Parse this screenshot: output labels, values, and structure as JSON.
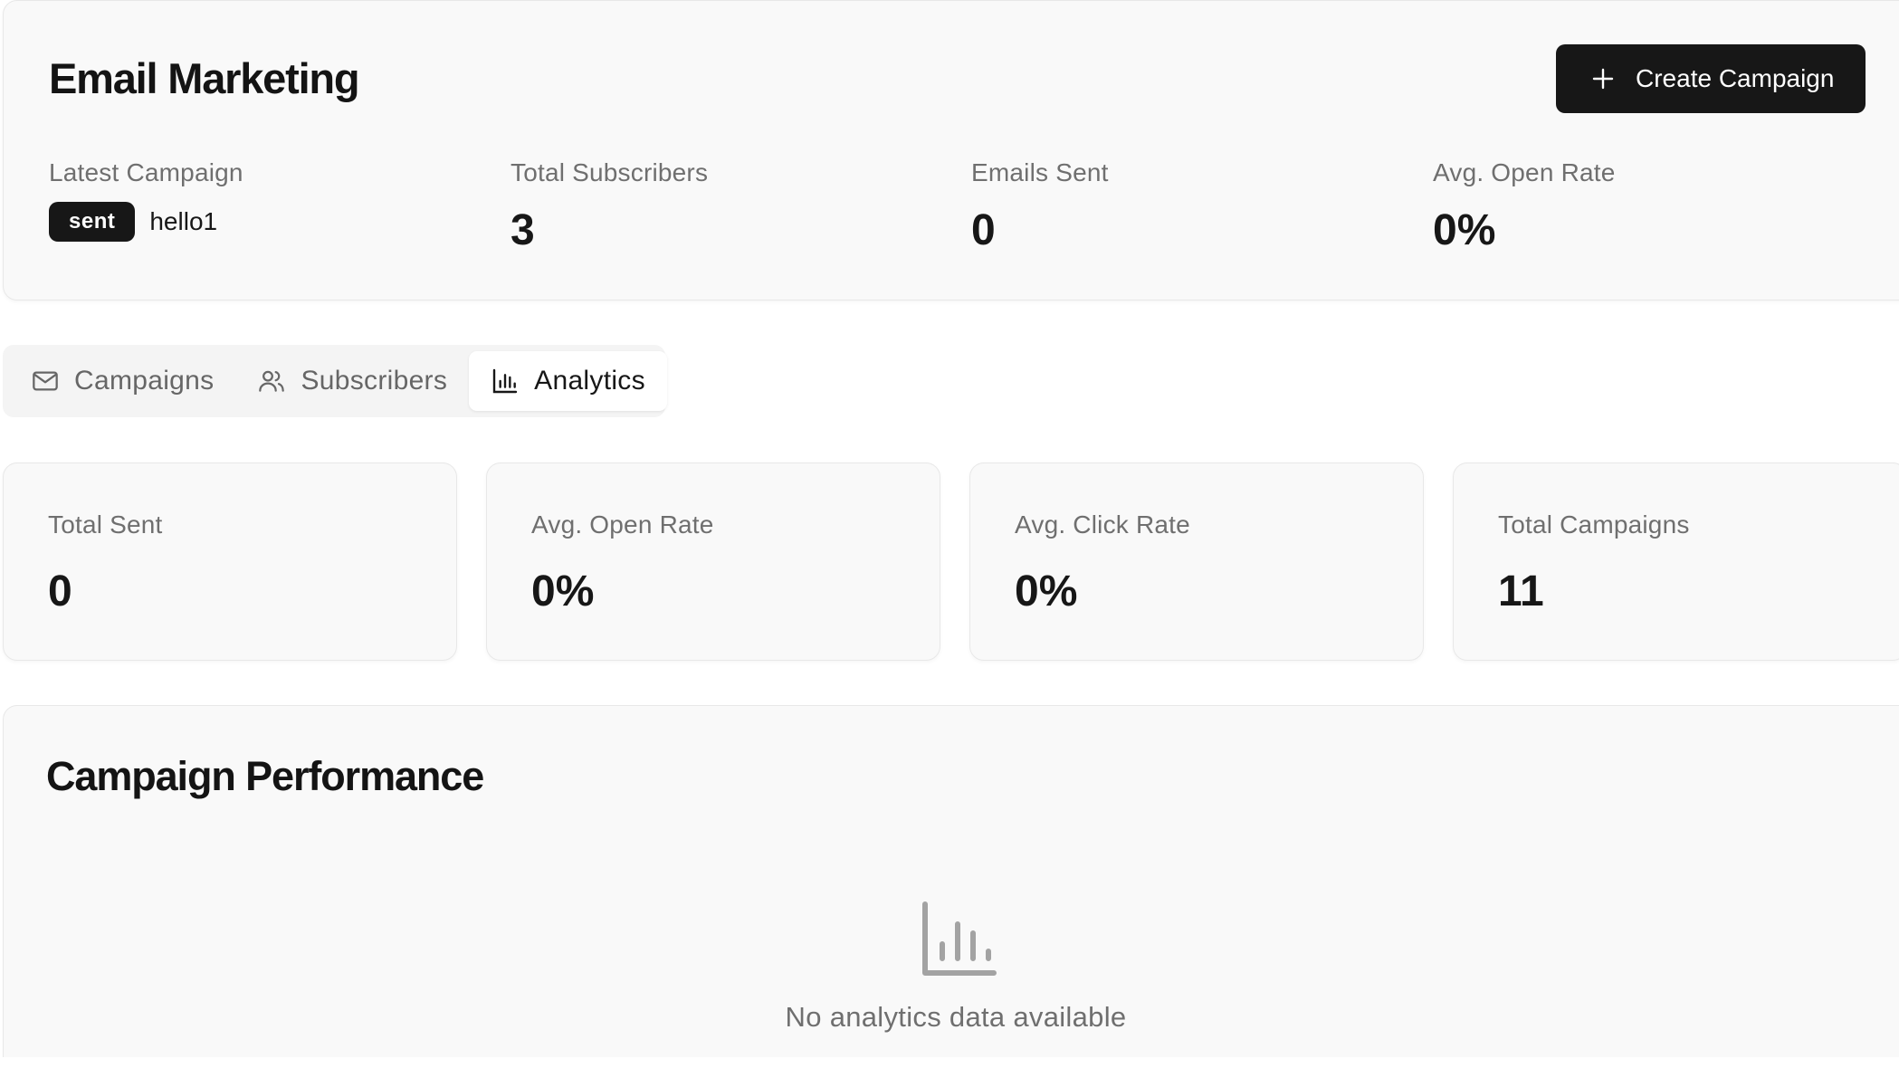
{
  "header": {
    "title": "Email Marketing",
    "create_button_label": "Create Campaign"
  },
  "summary": {
    "latest_campaign": {
      "label": "Latest Campaign",
      "status": "sent",
      "name": "hello1"
    },
    "total_subscribers": {
      "label": "Total Subscribers",
      "value": "3"
    },
    "emails_sent": {
      "label": "Emails Sent",
      "value": "0"
    },
    "avg_open_rate": {
      "label": "Avg. Open Rate",
      "value": "0%"
    }
  },
  "tabs": [
    {
      "label": "Campaigns",
      "icon": "mail-icon",
      "active": false
    },
    {
      "label": "Subscribers",
      "icon": "users-icon",
      "active": false
    },
    {
      "label": "Analytics",
      "icon": "bar-chart-icon",
      "active": true
    }
  ],
  "metrics": [
    {
      "label": "Total Sent",
      "value": "0"
    },
    {
      "label": "Avg. Open Rate",
      "value": "0%"
    },
    {
      "label": "Avg. Click Rate",
      "value": "0%"
    },
    {
      "label": "Total Campaigns",
      "value": "11"
    }
  ],
  "performance": {
    "title": "Campaign Performance",
    "empty_icon": "bar-chart-icon",
    "empty_message": "No analytics data available"
  },
  "colors": {
    "primary": "#171717",
    "card_background": "#f9f9f9",
    "muted_text": "#6f6f6f",
    "empty_icon": "#a3a3a3"
  }
}
